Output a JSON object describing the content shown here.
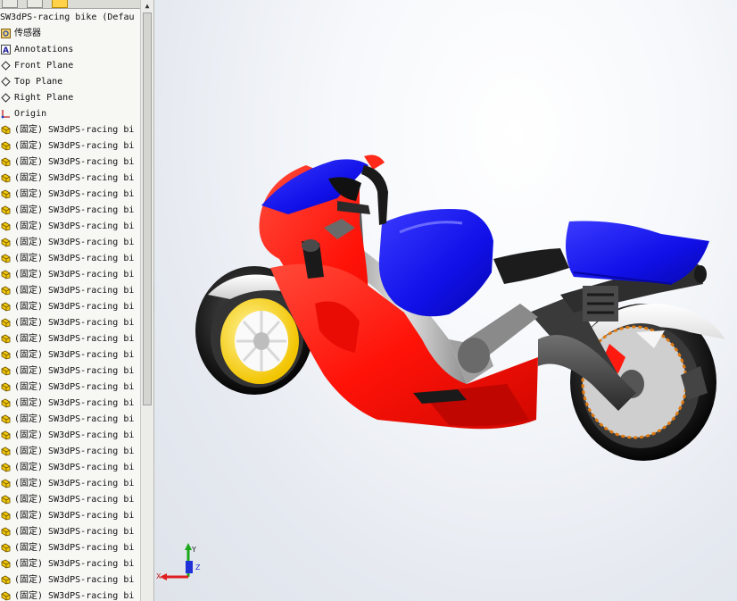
{
  "tree": {
    "root_label": "SW3dPS-racing bike  (Defau",
    "items": [
      {
        "label": "传感器",
        "icon": "sensor-icon"
      },
      {
        "label": "Annotations",
        "icon": "annotations-icon"
      },
      {
        "label": "Front Plane",
        "icon": "plane-icon"
      },
      {
        "label": "Top Plane",
        "icon": "plane-icon"
      },
      {
        "label": "Right Plane",
        "icon": "plane-icon"
      },
      {
        "label": "Origin",
        "icon": "origin-icon"
      }
    ],
    "part_label": "(固定) SW3dPS-racing bi",
    "part_icon": "part-icon",
    "part_count": 30
  },
  "triad": {
    "x_label": "X",
    "y_label": "Y",
    "z_label": "Z"
  },
  "colors": {
    "body_red": "#ff1a10",
    "tank_blue": "#1616f0",
    "rim_yellow": "#f8d21a",
    "frame_gray": "#b4b4b4",
    "tire_black": "#1a1a1a",
    "axis_x": "#e02020",
    "axis_y": "#1aa81a",
    "axis_z": "#2030d8"
  }
}
